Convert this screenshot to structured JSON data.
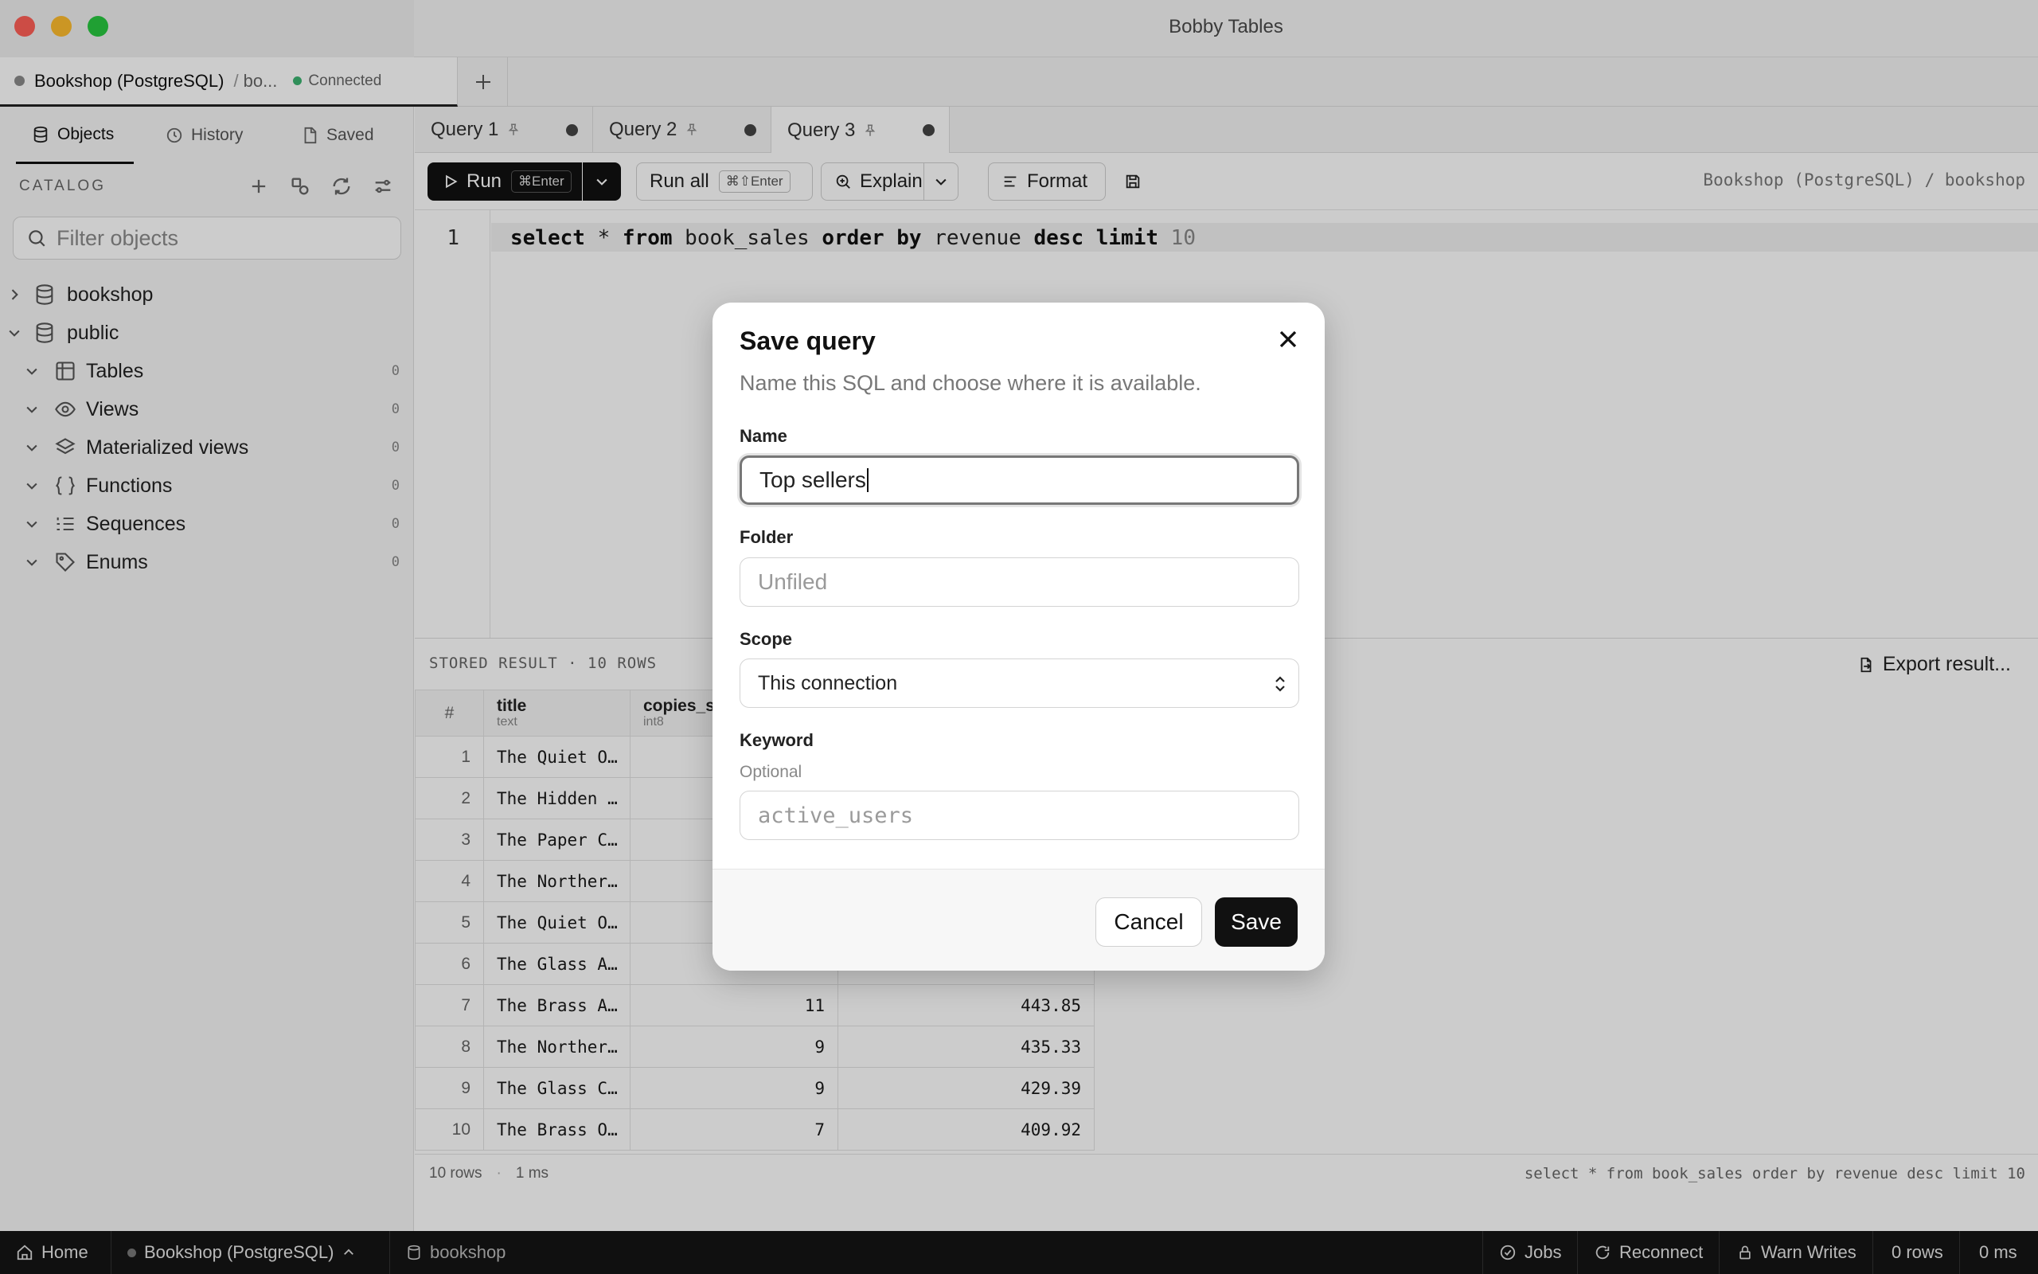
{
  "window": {
    "title": "Bobby Tables"
  },
  "connection_tab": {
    "name": "Bookshop (PostgreSQL)",
    "separator": "/",
    "db_short": "bo...",
    "status": "Connected"
  },
  "sidebar": {
    "tabs": [
      {
        "label": "Objects"
      },
      {
        "label": "History"
      },
      {
        "label": "Saved"
      }
    ],
    "catalog_label": "CATALOG",
    "filter_placeholder": "Filter objects",
    "tree": [
      {
        "label": "bookshop"
      },
      {
        "label": "public"
      },
      {
        "label": "Tables",
        "count": "0"
      },
      {
        "label": "Views",
        "count": "0"
      },
      {
        "label": "Materialized views",
        "count": "0"
      },
      {
        "label": "Functions",
        "count": "0"
      },
      {
        "label": "Sequences",
        "count": "0"
      },
      {
        "label": "Enums",
        "count": "0"
      }
    ]
  },
  "query_tabs": [
    {
      "label": "Query 1"
    },
    {
      "label": "Query 2"
    },
    {
      "label": "Query 3"
    }
  ],
  "toolbar": {
    "run_label": "Run",
    "run_shortcut": "⌘Enter",
    "run_all_label": "Run all",
    "run_all_shortcut": "⌘⇧Enter",
    "explain_label": "Explain",
    "format_label": "Format",
    "connection_path": "Bookshop (PostgreSQL) / bookshop"
  },
  "editor": {
    "line_number": "1",
    "tokens": [
      {
        "t": "select",
        "k": true
      },
      {
        "t": " * ",
        "k": false
      },
      {
        "t": "from",
        "k": true
      },
      {
        "t": " book_sales ",
        "k": false
      },
      {
        "t": "order by",
        "k": true
      },
      {
        "t": " revenue ",
        "k": false
      },
      {
        "t": "desc limit",
        "k": true
      },
      {
        "t": " 10",
        "k": false,
        "num": true
      }
    ]
  },
  "results": {
    "header": "STORED RESULT · 10 ROWS",
    "export_label": "Export result...",
    "columns": [
      {
        "name": "#",
        "type": ""
      },
      {
        "name": "title",
        "type": "text"
      },
      {
        "name": "copies_s",
        "type": "int8"
      },
      {
        "name": "",
        "type": ""
      }
    ],
    "rows": [
      [
        "1",
        "The Quiet O…",
        "",
        ""
      ],
      [
        "2",
        "The Hidden …",
        "",
        ""
      ],
      [
        "3",
        "The Paper C…",
        "",
        ""
      ],
      [
        "4",
        "The Norther…",
        "",
        ""
      ],
      [
        "5",
        "The Quiet O…",
        "",
        ""
      ],
      [
        "6",
        "The Glass A…",
        "",
        ""
      ],
      [
        "7",
        "The Brass A…",
        "11",
        "443.85"
      ],
      [
        "8",
        "The Norther…",
        "9",
        "435.33"
      ],
      [
        "9",
        "The Glass C…",
        "9",
        "429.39"
      ],
      [
        "10",
        "The Brass O…",
        "7",
        "409.92"
      ]
    ],
    "footer_rows": "10 rows",
    "footer_sep": "·",
    "footer_time": "1 ms",
    "footer_sql": "select * from book_sales order by revenue desc limit 10"
  },
  "statusbar": {
    "home": "Home",
    "connection": "Bookshop (PostgreSQL)",
    "database": "bookshop",
    "jobs": "Jobs",
    "reconnect": "Reconnect",
    "warn_writes": "Warn Writes",
    "rows": "0 rows",
    "time": "0 ms"
  },
  "modal": {
    "title": "Save query",
    "description": "Name this SQL and choose where it is available.",
    "name_label": "Name",
    "name_value": "Top sellers",
    "folder_label": "Folder",
    "folder_placeholder": "Unfiled",
    "scope_label": "Scope",
    "scope_value": "This connection",
    "keyword_label": "Keyword",
    "keyword_hint": "Optional",
    "keyword_placeholder": "active_users",
    "cancel_label": "Cancel",
    "save_label": "Save"
  },
  "colors": {
    "connected": "#3cb371",
    "close_light": "#ff5f57",
    "minimize_light": "#febc2e",
    "zoom_light": "#28c840",
    "accent_dark": "#111111"
  }
}
